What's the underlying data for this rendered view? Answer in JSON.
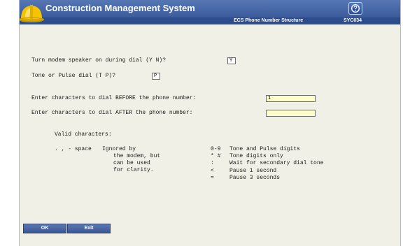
{
  "app": {
    "title": "Construction Management System",
    "screen_name": "ECS Phone Number Structure",
    "screen_code": "SYC034",
    "help_icon": "help-icon"
  },
  "form": {
    "speaker": {
      "label": "Turn modem speaker on during dial (Y N)?",
      "value": "Y"
    },
    "dial_mode": {
      "label": "Tone or Pulse dial (T P)?",
      "value": "P"
    },
    "before_chars": {
      "label": "Enter characters to dial BEFORE the phone number:",
      "value": "1"
    },
    "after_chars": {
      "label": "Enter characters to dial AFTER the phone number:",
      "value": ""
    }
  },
  "help": {
    "heading": "Valid characters:",
    "left_rows": [
      {
        "chars": ". , - space",
        "desc": "Ignored by"
      },
      {
        "chars": "",
        "desc": "the modem, but"
      },
      {
        "chars": "",
        "desc": "can be used"
      },
      {
        "chars": "",
        "desc": "for clarity."
      }
    ],
    "right_rows": [
      {
        "chars": "0-9",
        "desc": "Tone and Pulse digits"
      },
      {
        "chars": "* #",
        "desc": "Tone digits only"
      },
      {
        "chars": ":",
        "desc": "Wait for secondary dial tone"
      },
      {
        "chars": "<",
        "desc": "Pause 1 second"
      },
      {
        "chars": "=",
        "desc": "Pause 3 seconds"
      }
    ]
  },
  "buttons": {
    "ok": "OK",
    "exit": "Exit"
  },
  "colors": {
    "titlebar": "#3b5b9c",
    "background": "#f1f0e6",
    "input_fill": "#ffffcc"
  }
}
